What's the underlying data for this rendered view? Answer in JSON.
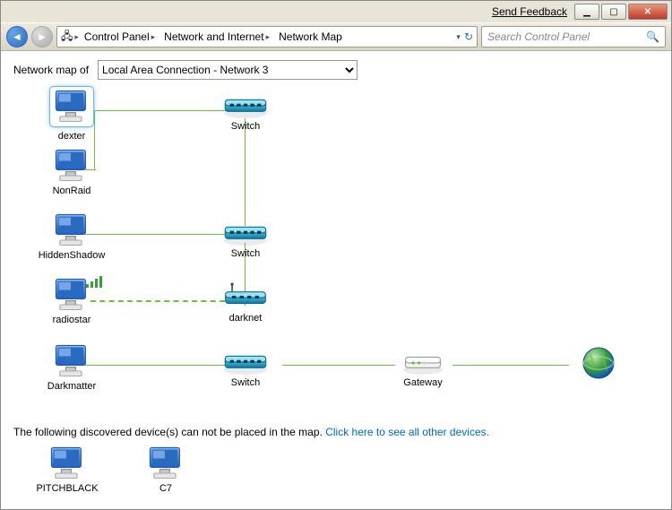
{
  "titlebar": {
    "feedback": "Send Feedback"
  },
  "navbar": {
    "breadcrumbs": [
      "Control Panel",
      "Network and Internet",
      "Network Map"
    ],
    "search_placeholder": "Search Control Panel"
  },
  "filter": {
    "label": "Network map of",
    "selected": "Local Area Connection - Network 3"
  },
  "map": {
    "nodes": {
      "dexter": {
        "label": "dexter",
        "type": "computer",
        "selected": true
      },
      "nonraid": {
        "label": "NonRaid",
        "type": "computer"
      },
      "hiddenshadow": {
        "label": "HiddenShadow",
        "type": "computer"
      },
      "radiostar": {
        "label": "radiostar",
        "type": "computer-wifi"
      },
      "darkmatter": {
        "label": "Darkmatter",
        "type": "computer"
      },
      "switch1": {
        "label": "Switch",
        "type": "switch"
      },
      "switch2": {
        "label": "Switch",
        "type": "switch"
      },
      "switch3": {
        "label": "Switch",
        "type": "switch"
      },
      "darknet": {
        "label": "darknet",
        "type": "router"
      },
      "gateway": {
        "label": "Gateway",
        "type": "gateway"
      },
      "internet": {
        "label": "",
        "type": "internet"
      }
    }
  },
  "footer": {
    "message_prefix": "The following discovered device(s) can not be placed in the map. ",
    "link_text": "Click here to see all other devices.",
    "unplaced": [
      {
        "label": "PITCHBLACK",
        "type": "computer"
      },
      {
        "label": "C7",
        "type": "computer"
      }
    ]
  }
}
